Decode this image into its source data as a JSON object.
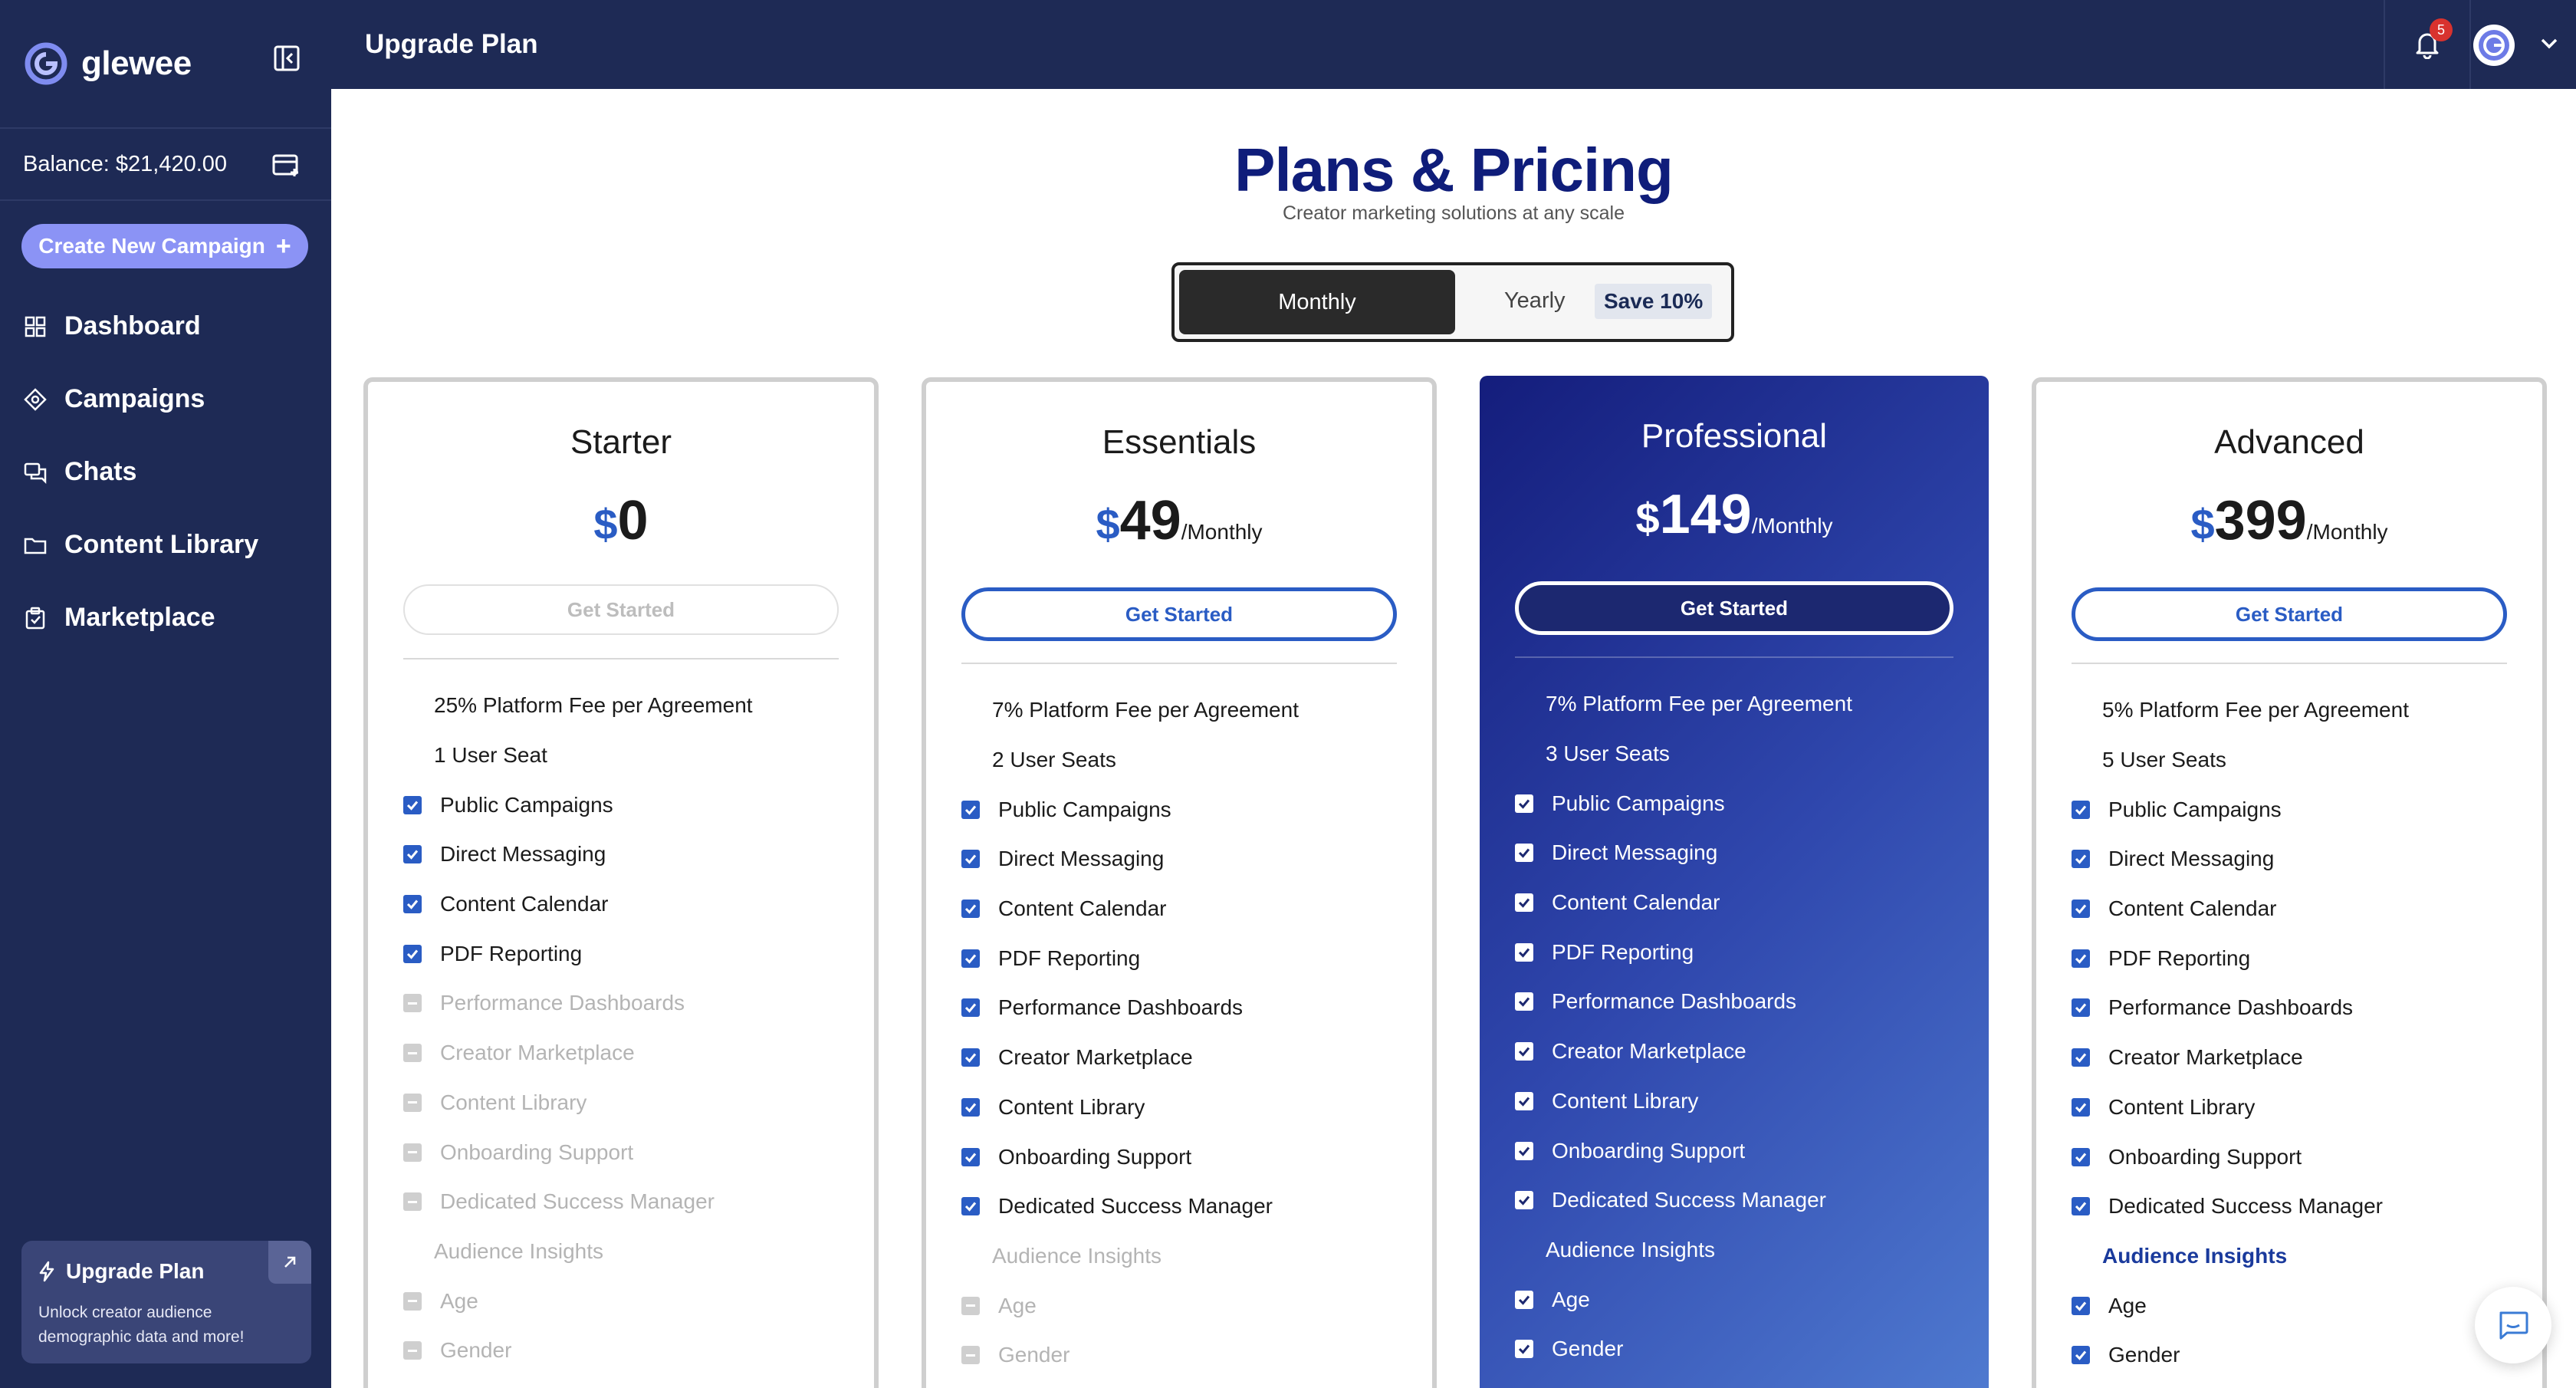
{
  "app": {
    "name": "glewee"
  },
  "sidebar": {
    "balance": "Balance: $21,420.00",
    "create_label": "Create New Campaign",
    "create_plus": "+",
    "items": [
      {
        "label": "Dashboard",
        "icon": "dashboard-icon"
      },
      {
        "label": "Campaigns",
        "icon": "campaigns-icon"
      },
      {
        "label": "Chats",
        "icon": "chats-icon"
      },
      {
        "label": "Content Library",
        "icon": "folder-icon"
      },
      {
        "label": "Marketplace",
        "icon": "marketplace-icon"
      }
    ],
    "upgrade": {
      "title": "Upgrade Plan",
      "desc_line1": "Unlock creator audience",
      "desc_line2": "demographic data and more!"
    }
  },
  "topbar": {
    "title": "Upgrade Plan",
    "notification_count": "5"
  },
  "main": {
    "title": "Plans & Pricing",
    "subtitle": "Creator marketing solutions at any scale",
    "billing": {
      "monthly": "Monthly",
      "yearly": "Yearly",
      "save": "Save 10%"
    }
  },
  "plans": [
    {
      "name": "Starter",
      "currency": "$",
      "price": "0",
      "period": "",
      "cta": "Get Started",
      "features": [
        {
          "text": "25% Platform Fee per Agreement",
          "state": "info"
        },
        {
          "text": "1 User Seat",
          "state": "info"
        },
        {
          "text": "Public Campaigns",
          "state": "on"
        },
        {
          "text": "Direct Messaging",
          "state": "on"
        },
        {
          "text": "Content Calendar",
          "state": "on"
        },
        {
          "text": "PDF Reporting",
          "state": "on"
        },
        {
          "text": "Performance Dashboards",
          "state": "off"
        },
        {
          "text": "Creator Marketplace",
          "state": "off"
        },
        {
          "text": "Content Library",
          "state": "off"
        },
        {
          "text": "Onboarding Support",
          "state": "off"
        },
        {
          "text": "Dedicated Success Manager",
          "state": "off"
        },
        {
          "text": "Audience Insights",
          "state": "heading-off"
        },
        {
          "text": "Age",
          "state": "off"
        },
        {
          "text": "Gender",
          "state": "off"
        }
      ]
    },
    {
      "name": "Essentials",
      "currency": "$",
      "price": "49",
      "period": "/Monthly",
      "cta": "Get Started",
      "features": [
        {
          "text": "7% Platform Fee per Agreement",
          "state": "info"
        },
        {
          "text": "2 User Seats",
          "state": "info"
        },
        {
          "text": "Public Campaigns",
          "state": "on"
        },
        {
          "text": "Direct Messaging",
          "state": "on"
        },
        {
          "text": "Content Calendar",
          "state": "on"
        },
        {
          "text": "PDF Reporting",
          "state": "on"
        },
        {
          "text": "Performance Dashboards",
          "state": "on"
        },
        {
          "text": "Creator Marketplace",
          "state": "on"
        },
        {
          "text": "Content Library",
          "state": "on"
        },
        {
          "text": "Onboarding Support",
          "state": "on"
        },
        {
          "text": "Dedicated Success Manager",
          "state": "on"
        },
        {
          "text": "Audience Insights",
          "state": "heading-off"
        },
        {
          "text": "Age",
          "state": "off"
        },
        {
          "text": "Gender",
          "state": "off"
        }
      ]
    },
    {
      "name": "Professional",
      "currency": "$",
      "price": "149",
      "period": "/Monthly",
      "cta": "Get Started",
      "features": [
        {
          "text": "7% Platform Fee per Agreement",
          "state": "info"
        },
        {
          "text": "3 User Seats",
          "state": "info"
        },
        {
          "text": "Public Campaigns",
          "state": "on"
        },
        {
          "text": "Direct Messaging",
          "state": "on"
        },
        {
          "text": "Content Calendar",
          "state": "on"
        },
        {
          "text": "PDF Reporting",
          "state": "on"
        },
        {
          "text": "Performance Dashboards",
          "state": "on"
        },
        {
          "text": "Creator Marketplace",
          "state": "on"
        },
        {
          "text": "Content Library",
          "state": "on"
        },
        {
          "text": "Onboarding Support",
          "state": "on"
        },
        {
          "text": "Dedicated Success Manager",
          "state": "on"
        },
        {
          "text": "Audience Insights",
          "state": "heading-on"
        },
        {
          "text": "Age",
          "state": "on"
        },
        {
          "text": "Gender",
          "state": "on"
        }
      ]
    },
    {
      "name": "Advanced",
      "currency": "$",
      "price": "399",
      "period": "/Monthly",
      "cta": "Get Started",
      "features": [
        {
          "text": "5% Platform Fee per Agreement",
          "state": "info"
        },
        {
          "text": "5 User Seats",
          "state": "info"
        },
        {
          "text": "Public Campaigns",
          "state": "on"
        },
        {
          "text": "Direct Messaging",
          "state": "on"
        },
        {
          "text": "Content Calendar",
          "state": "on"
        },
        {
          "text": "PDF Reporting",
          "state": "on"
        },
        {
          "text": "Performance Dashboards",
          "state": "on"
        },
        {
          "text": "Creator Marketplace",
          "state": "on"
        },
        {
          "text": "Content Library",
          "state": "on"
        },
        {
          "text": "Onboarding Support",
          "state": "on"
        },
        {
          "text": "Dedicated Success Manager",
          "state": "on"
        },
        {
          "text": "Audience Insights",
          "state": "heading-link"
        },
        {
          "text": "Age",
          "state": "on"
        },
        {
          "text": "Gender",
          "state": "on"
        }
      ]
    }
  ],
  "colors": {
    "navy": "#1e2a55",
    "accent": "#2a5cc4",
    "heading": "#0f1d7a",
    "create_button": "#8b93f5"
  }
}
